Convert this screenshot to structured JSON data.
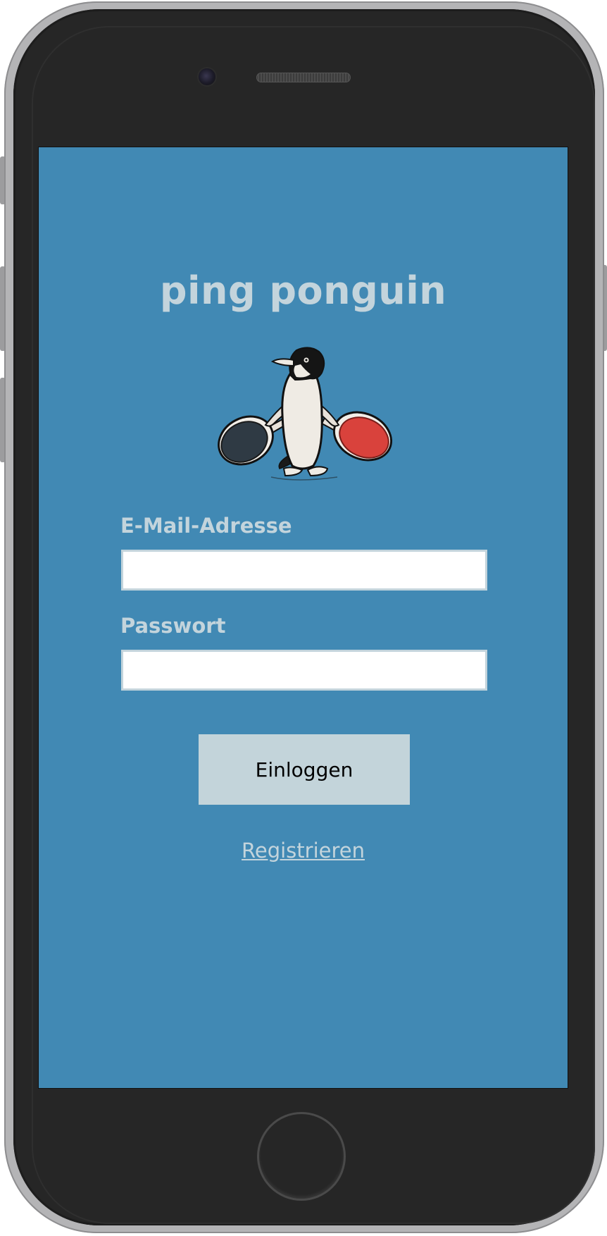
{
  "app": {
    "title": "ping ponguin"
  },
  "form": {
    "email_label": "E-Mail-Adresse",
    "email_value": "",
    "email_placeholder": "",
    "password_label": "Passwort",
    "password_value": "",
    "password_placeholder": "",
    "login_label": "Einloggen",
    "register_label": "Registrieren"
  },
  "logo": {
    "icon": "penguin-with-ping-pong-paddles-icon"
  },
  "colors": {
    "screen_background": "#4189b4",
    "text_light": "#c3d4dc",
    "button_background": "#c3d4da",
    "paddle_left": "#2f3a44",
    "paddle_right": "#d9423c"
  }
}
